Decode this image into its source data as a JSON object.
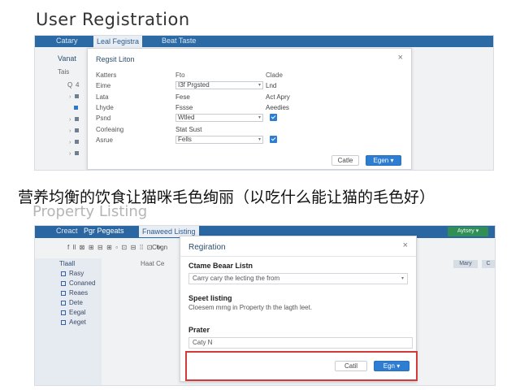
{
  "headings": {
    "top": "User Registration",
    "caption": "营养均衡的饮食让猫咪毛色绚丽（以吃什么能让猫的毛色好）",
    "bottom": "Property Listing"
  },
  "panel1": {
    "tabs": [
      "Catary",
      "Leal Fegistra",
      "Beat Taste"
    ],
    "bg_labels": [
      "Vanat",
      "Tais",
      "Q",
      "4"
    ],
    "dialog": {
      "title": "Regsit Liton",
      "close": "×",
      "col_headers": [
        "Katters",
        "Fto",
        "Clade"
      ],
      "rows": [
        {
          "label": "Eime",
          "value": "I3f Prgsted",
          "extra": "Lnd"
        },
        {
          "label": "Lata",
          "value": "Fese",
          "extra": "Act Apry"
        },
        {
          "label": "Lhyde",
          "value": "Fssse",
          "extra": "Aeedies"
        },
        {
          "label": "Psnd",
          "value": "Wtled",
          "extra": ""
        },
        {
          "label": "Corleaing",
          "value": "Stat Sust",
          "extra": ""
        },
        {
          "label": "Asrue",
          "value": "Fells",
          "extra": ""
        }
      ],
      "cancel_label": "Catle",
      "primary_label": "Egen ▾"
    }
  },
  "panel2": {
    "tabs": [
      "Creact",
      "Pgr Pegeats",
      "Fnaweed Listing"
    ],
    "green_button": "Aytsey ▾",
    "toolbar": "Cegn",
    "side_items": [
      "Tlaall",
      "Rasy",
      "Conaned",
      "Reaes",
      "Dete",
      "Eegal",
      "Aeget"
    ],
    "bg_label": "Haat Ce",
    "right_buttons": [
      "Mary",
      "C"
    ],
    "dialog": {
      "title": "Regiration",
      "close": "×",
      "section1_title": "Ctame Beaar Listn",
      "section1_value": "Carry cary the lecting the from",
      "section2_title": "Speet listing",
      "section2_desc": "Cloesem mrng in Property th the lagth leet.",
      "section3_title": "Prater",
      "section3_value": "Caty N",
      "cancel_label": "Catil",
      "primary_label": "Egn ▾"
    }
  }
}
